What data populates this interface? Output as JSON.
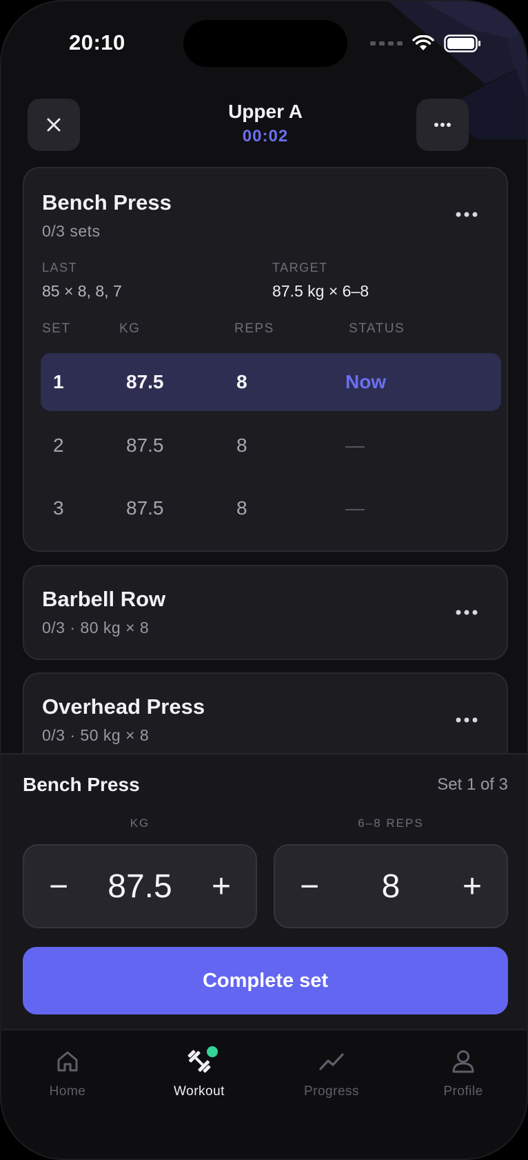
{
  "status_bar": {
    "time": "20:10"
  },
  "header": {
    "title": "Upper A",
    "timer": "00:02"
  },
  "current_exercise": {
    "name": "Bench Press",
    "progress": "0/3 sets",
    "last_label": "LAST",
    "last_value": "85 × 8, 8, 7",
    "target_label": "TARGET",
    "target_value": "87.5 kg × 6–8",
    "columns": [
      "SET",
      "KG",
      "REPS",
      "STATUS"
    ],
    "sets": [
      {
        "set": "1",
        "kg": "87.5",
        "reps": "8",
        "status": "Now"
      },
      {
        "set": "2",
        "kg": "87.5",
        "reps": "8",
        "status": "—"
      },
      {
        "set": "3",
        "kg": "87.5",
        "reps": "8",
        "status": "—"
      }
    ]
  },
  "upcoming": [
    {
      "name": "Barbell Row",
      "summary": "0/3 · 80 kg × 8"
    },
    {
      "name": "Overhead Press",
      "summary": "0/3 · 50 kg × 8"
    }
  ],
  "sheet": {
    "exercise": "Bench Press",
    "set_indicator": "Set 1 of 3",
    "kg_label": "KG",
    "kg_value": "87.5",
    "reps_label": "6–8 REPS",
    "reps_value": "8",
    "minus": "−",
    "plus": "+",
    "complete_label": "Complete set"
  },
  "tabs": [
    {
      "label": "Home",
      "icon": "home-icon"
    },
    {
      "label": "Workout",
      "icon": "dumbbell-icon",
      "active": true
    },
    {
      "label": "Progress",
      "icon": "chart-line-icon"
    },
    {
      "label": "Profile",
      "icon": "user-icon"
    }
  ],
  "colors": {
    "accent": "#6366f1",
    "active_row": "#2e2e52",
    "badge": "#34d399",
    "background": "#101013",
    "card": "#1c1c21"
  }
}
